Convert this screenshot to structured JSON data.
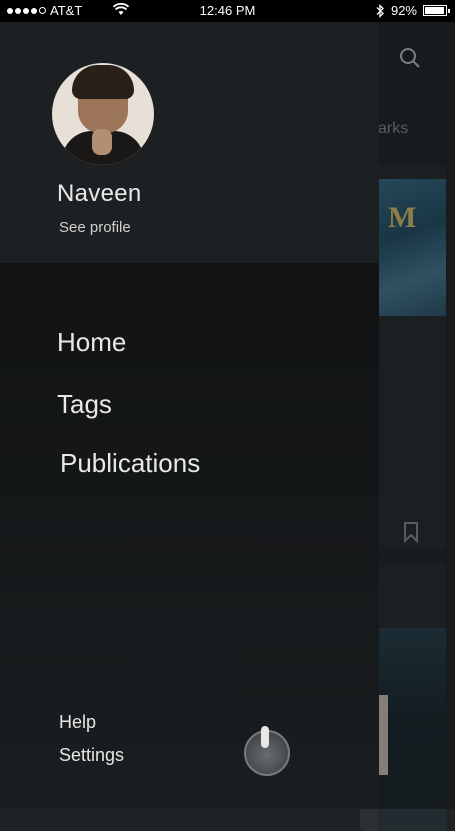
{
  "status_bar": {
    "carrier": "AT&T",
    "time": "12:46 PM",
    "battery": "92%",
    "battery_level": 0.92
  },
  "background": {
    "tab_partial_label": "arks"
  },
  "drawer": {
    "user_name": "Naveen",
    "see_profile": "See profile",
    "nav_items": [
      "Home",
      "Tags",
      "Publications"
    ],
    "footer": {
      "help": "Help",
      "settings": "Settings"
    }
  },
  "icons": {
    "search": "search-icon",
    "bookmark": "bookmark-icon",
    "wifi": "wifi-icon",
    "bluetooth": "bluetooth-icon",
    "battery": "battery-icon"
  },
  "colors": {
    "drawer_bg": "#121415",
    "profile_bg": "#1d2022",
    "text": "#e8e8e8"
  }
}
